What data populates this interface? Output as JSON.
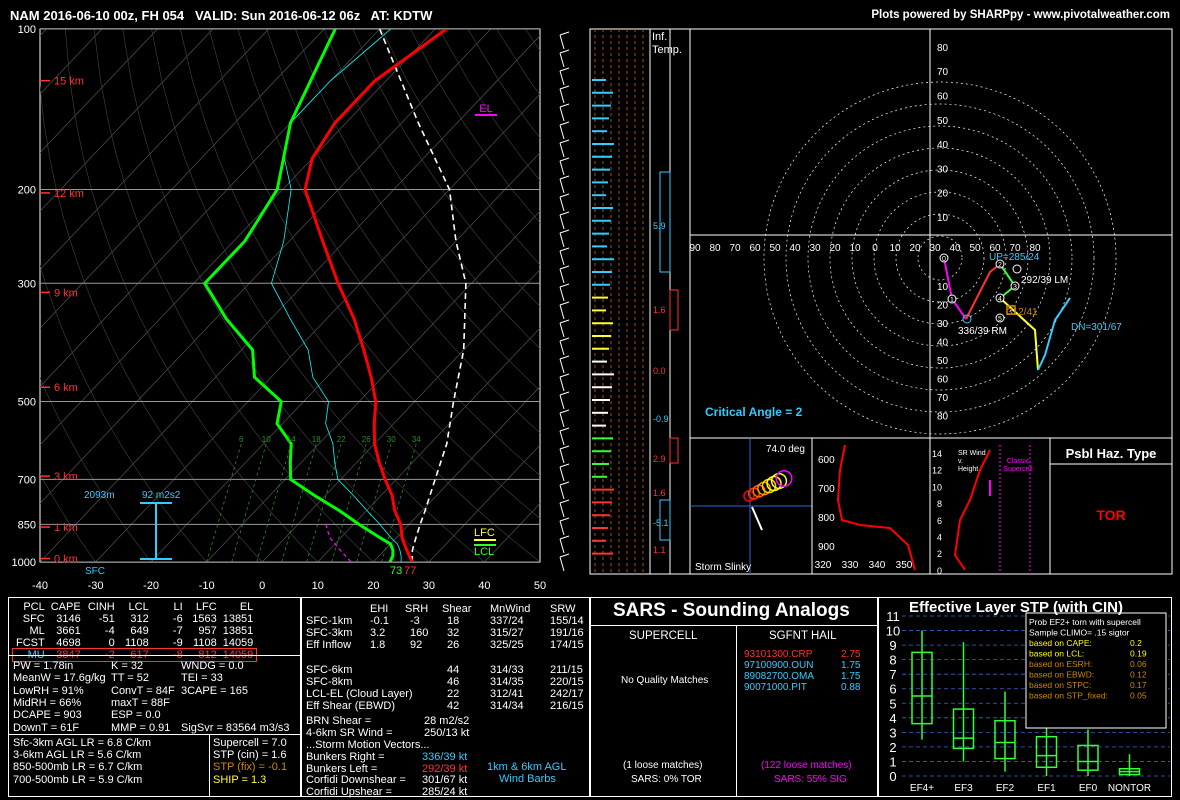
{
  "header": {
    "title": "NAM 2016-06-10 00z, FH 054   VALID: Sun 2016-06-12 06z   AT: KDTW",
    "credit": "Plots powered by SHARPpy - www.pivotalweather.com"
  },
  "skewt": {
    "pressure_labels": [
      "100",
      "200",
      "300",
      "500",
      "700",
      "850",
      "1000"
    ],
    "pressures": [
      100,
      200,
      300,
      500,
      700,
      850,
      1000
    ],
    "temp_ticks": [
      "-40",
      "-30",
      "-20",
      "-10",
      "0",
      "10",
      "20",
      "30",
      "40",
      "50"
    ],
    "temp_values": [
      -40,
      -30,
      -20,
      -10,
      0,
      10,
      20,
      30,
      40,
      50
    ],
    "height_labels": [
      "15 km",
      "12 km",
      "9 km",
      "6 km",
      "3 km",
      "1 km",
      "0 km"
    ],
    "height_pressures": [
      125,
      203,
      312,
      470,
      690,
      860,
      985
    ],
    "el_label": "EL",
    "lfc_label": "LFC",
    "lcl_label": "LCL",
    "sfc_label": "SFC",
    "sfc_temp": "73",
    "sfc_dew": "77",
    "eff_depth": "2093m",
    "eff_srh": "92 m2s2",
    "mixing_ratios": [
      "6",
      "10",
      "14",
      "18",
      "22",
      "26",
      "30",
      "34"
    ],
    "colors": {
      "temp": "#ff0000",
      "dew": "#00ff00",
      "parcel": "#ffffff",
      "wetbulb": "#00ffff"
    }
  },
  "chart_data": [
    {
      "type": "line",
      "title": "Skew-T",
      "xlabel": "",
      "ylabel": "",
      "ylim": [
        1000,
        100
      ],
      "xlim": [
        -40,
        50
      ],
      "series": [
        {
          "p": [
            1000,
            975,
            950,
            925,
            900,
            850,
            800,
            750,
            700,
            650,
            600,
            550,
            500,
            450,
            400,
            350,
            300,
            250,
            200,
            175,
            150,
            125,
            100
          ],
          "t": [
            27,
            25.5,
            24,
            22.5,
            21,
            18.5,
            15,
            12,
            8,
            4,
            0,
            -3.5,
            -7,
            -12,
            -18,
            -25,
            -34,
            -44,
            -56,
            -60,
            -62,
            -62,
            -58
          ]
        },
        {
          "p": [
            1000,
            975,
            950,
            925,
            900,
            850,
            800,
            750,
            700,
            650,
            600,
            550,
            500,
            450,
            400,
            350,
            300,
            250,
            200,
            150,
            100
          ],
          "td": [
            23,
            22.5,
            21.5,
            20,
            17,
            11,
            5,
            -2,
            -9,
            -12,
            -15,
            -21,
            -24,
            -33,
            -38,
            -48,
            -58,
            -58,
            -61,
            -70,
            -78
          ]
        },
        {
          "p": [
            1000,
            950,
            900,
            850,
            800,
            700,
            600,
            500,
            400,
            300,
            250,
            200,
            150,
            100
          ],
          "parcel": [
            27,
            25,
            23.5,
            22,
            20.5,
            17,
            13,
            7,
            0,
            -11,
            -20,
            -30,
            -47,
            -70
          ]
        }
      ]
    },
    {
      "type": "table",
      "title": "Parcel",
      "columns": [
        "PCL",
        "CAPE",
        "CINH",
        "LCL",
        "LI",
        "LFC",
        "EL"
      ],
      "rows": [
        [
          "SFC",
          "3146",
          "-51",
          "312",
          "-6",
          "1563",
          "13851"
        ],
        [
          "ML",
          "3661",
          "-4",
          "649",
          "-7",
          "957",
          "13851"
        ],
        [
          "FCST",
          "4698",
          "0",
          "1108",
          "-9",
          "1108",
          "14059"
        ],
        [
          "MU",
          "3847",
          "-2",
          "617",
          "-8",
          "812",
          "14059"
        ]
      ]
    },
    {
      "type": "bar",
      "title": "Effective Layer STP (with CIN)",
      "categories": [
        "EF4+",
        "EF3",
        "EF2",
        "EF1",
        "EF0",
        "NONTOR"
      ],
      "ylim": [
        0,
        11
      ],
      "boxes": [
        {
          "lo": 2.5,
          "q1": 3.6,
          "med": 5.5,
          "q3": 8.5,
          "hi": 10.0
        },
        {
          "lo": 1.0,
          "q1": 1.9,
          "med": 2.6,
          "q3": 4.6,
          "hi": 9.2
        },
        {
          "lo": 0.3,
          "q1": 1.2,
          "med": 2.3,
          "q3": 3.8,
          "hi": 5.8
        },
        {
          "lo": 0.0,
          "q1": 0.6,
          "med": 1.4,
          "q3": 2.7,
          "hi": 5.0
        },
        {
          "lo": 0.0,
          "q1": 0.4,
          "med": 1.0,
          "q3": 2.1,
          "hi": 3.2
        },
        {
          "lo": 0.0,
          "q1": 0.1,
          "med": 0.3,
          "q3": 0.5,
          "hi": 1.5
        }
      ],
      "value_stp": 1.6
    }
  ],
  "profile_panels": {
    "inf_temp": "Inf.\nTemp.",
    "ticks": [
      "5.9",
      "1.6",
      "0.0",
      "-0.9",
      "2.9",
      "1.6",
      "-5.1",
      "1.1"
    ]
  },
  "hodograph": {
    "rings": [
      "10",
      "20",
      "30",
      "40",
      "50",
      "60",
      "70",
      "80"
    ],
    "axis": [
      "90",
      "80",
      "70",
      "60",
      "50",
      "40",
      "30",
      "20",
      "10",
      "0",
      "10",
      "20",
      "30",
      "40",
      "50",
      "60",
      "70",
      "80"
    ],
    "up": "UP=285/24",
    "lm": "292/39 LM",
    "rm": "336/39 RM",
    "dn": "DN=301/67",
    "eff": "312/41",
    "critical": "Critical Angle = 2",
    "points": [
      [
        0,
        0
      ],
      [
        1,
        5
      ],
      [
        2,
        7
      ],
      [
        3,
        10
      ],
      [
        4,
        18
      ],
      [
        5,
        22
      ]
    ]
  },
  "slinky": {
    "title": "74.0 deg",
    "label": "Storm Slinky",
    "plev": [
      "600",
      "700",
      "800",
      "900"
    ],
    "tlev": [
      "320",
      "330",
      "340",
      "350"
    ]
  },
  "wind_panel": {
    "title": "SR Wind\nv.\nHeight",
    "classic": "Classic\nSupercell",
    "yticks": [
      "14",
      "12",
      "10",
      "8",
      "6",
      "4",
      "2",
      "0"
    ]
  },
  "haz": {
    "title": "Psbl Haz. Type",
    "value": "TOR"
  },
  "thermo": {
    "lines": [
      "PW = 1.78in",
      "MeanW = 17.6g/kg",
      "LowRH = 91%",
      "MidRH = 66%",
      "DCAPE = 903",
      "DownT = 61F"
    ],
    "lines2": [
      "K = 32",
      "TT = 52",
      "ConvT = 84F",
      "maxT = 88F",
      "ESP = 0.0",
      "MMP = 0.91"
    ],
    "lines3": [
      "WNDG = 0.0",
      "TEI = 33",
      "3CAPE = 165",
      "",
      "",
      "SigSvr = 83564 m3/s3"
    ],
    "lr": [
      "Sfc-3km AGL LR = 6.8 C/km",
      "3-6km AGL LR = 5.6 C/km",
      "850-500mb LR = 6.7 C/km",
      "700-500mb LR = 5.9 C/km"
    ],
    "sc": [
      "Supercell = 7.0",
      "STP (cin) = 1.6",
      "STP (fix) = -0.1",
      "SHIP = 1.3"
    ]
  },
  "kin": {
    "head": [
      "EHI",
      "SRH",
      "Shear",
      "MnWind",
      "SRW"
    ],
    "rows": [
      [
        "SFC-1km",
        "-0.1",
        "-3",
        "18",
        "337/24",
        "155/14"
      ],
      [
        "SFC-3km",
        "3.2",
        "160",
        "32",
        "315/27",
        "191/16"
      ],
      [
        "Eff Inflow",
        "1.8",
        "92",
        "26",
        "325/25",
        "174/15"
      ],
      [
        "",
        "",
        "",
        "",
        "",
        ""
      ],
      [
        "SFC-6km",
        "",
        "",
        "44",
        "314/33",
        "211/15"
      ],
      [
        "SFC-8km",
        "",
        "",
        "46",
        "314/35",
        "220/15"
      ],
      [
        "LCL-EL (Cloud Layer)",
        "",
        "",
        "22",
        "312/41",
        "242/17"
      ],
      [
        "Eff Shear (EBWD)",
        "",
        "",
        "42",
        "314/34",
        "216/15"
      ]
    ],
    "brn": "BRN Shear =",
    "brn_v": "28 m2/s2",
    "sr46": "4-6km SR Wind =",
    "sr46_v": "250/13 kt",
    "smv": "...Storm Motion Vectors...",
    "bm": [
      [
        "Bunkers Right =",
        "336/39 kt"
      ],
      [
        "Bunkers Left =",
        "292/39 kt"
      ],
      [
        "Corfidi Downshear =",
        "301/67 kt"
      ],
      [
        "Corfidi Upshear =",
        "285/24 kt"
      ]
    ],
    "barbs": "1km & 6km AGL\nWind Barbs"
  },
  "sars": {
    "title": "SARS - Sounding Analogs",
    "sup": "SUPERCELL",
    "hail": "SGFNT HAIL",
    "noq": "No Quality Matches",
    "hail_rows": [
      [
        "93101300.CRP",
        "2.75"
      ],
      [
        "97100900.OUN",
        "1.75"
      ],
      [
        "89082700.OMA",
        "1.75"
      ],
      [
        "90071000.PIT",
        "0.88"
      ]
    ],
    "loose1": "(1 loose matches)",
    "loose2": "(122 loose matches)",
    "sars1": "SARS: 0% TOR",
    "sars2": "SARS: 55% SIG"
  },
  "stp": {
    "title": "Effective Layer STP (with CIN)",
    "legend": [
      "Prob EF2+ torn with supercell",
      "Sample CLIMO= .15 sigtor",
      "based on CAPE:",
      "based on LCL:",
      "based on ESRH:",
      "based on EBWD:",
      "based on STPC:",
      "based on STP_fixed:"
    ],
    "lvals": [
      "",
      "",
      "0.2",
      "0.19",
      "0.06",
      "0.12",
      "0.17",
      "0.05"
    ],
    "yticks": [
      "0",
      "1",
      "2",
      "3",
      "4",
      "5",
      "6",
      "7",
      "8",
      "9",
      "10",
      "11"
    ]
  }
}
